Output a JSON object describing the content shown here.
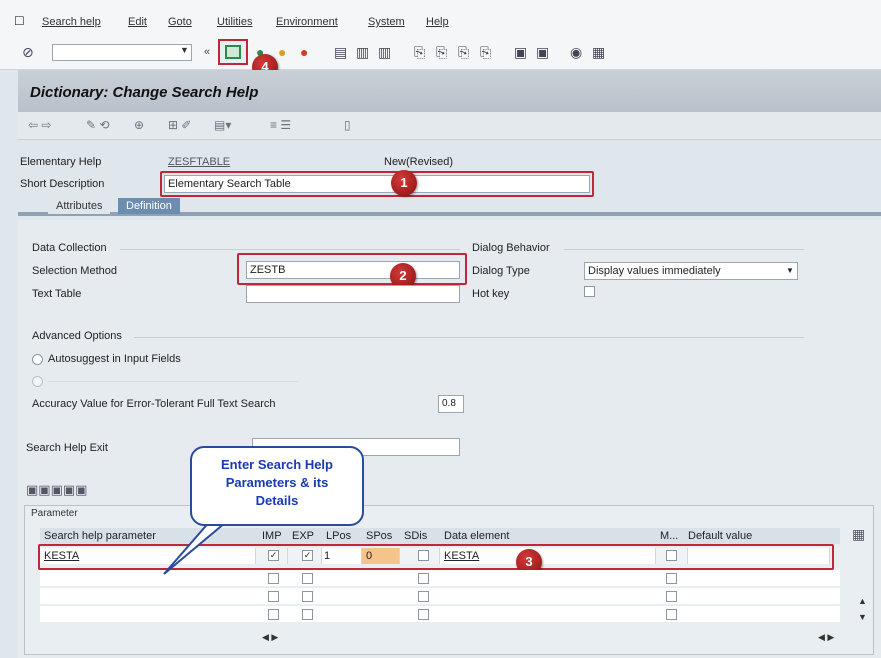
{
  "menu": {
    "items": [
      "Search help",
      "Edit",
      "Goto",
      "Utilities",
      "Environment",
      "System",
      "Help"
    ]
  },
  "toolbar": {
    "command_value": ""
  },
  "title": "Dictionary: Change Search Help",
  "header": {
    "elementary_label": "Elementary Help",
    "elementary_value": "ZESFTABLE",
    "status": "New(Revised)",
    "short_desc_label": "Short Description",
    "short_desc_value": "Elementary Search Table"
  },
  "tabs": [
    "Attributes",
    "Definition"
  ],
  "data_collection": {
    "heading": "Data Collection",
    "selection_method_label": "Selection Method",
    "selection_method_value": "ZESTB",
    "text_table_label": "Text Table",
    "text_table_value": ""
  },
  "dialog": {
    "heading": "Dialog Behavior",
    "type_label": "Dialog Type",
    "type_value": "Display values immediately",
    "hotkey_label": "Hot key"
  },
  "advanced": {
    "heading": "Advanced Options",
    "autosuggest_label": "Autosuggest in Input Fields",
    "accuracy_label": "Accuracy Value for Error-Tolerant Full Text Search",
    "accuracy_value": "0.8"
  },
  "exit": {
    "label": "Search Help Exit",
    "value": ""
  },
  "callout": {
    "text": "Enter Search Help\nParameters & its\nDetails"
  },
  "grid": {
    "group_title": "Parameter",
    "headers": [
      "Search help parameter",
      "IMP",
      "EXP",
      "LPos",
      "SPos",
      "SDis",
      "Data element",
      "M...",
      "Default value"
    ],
    "row1": {
      "param": "KESTA",
      "imp": "✓",
      "exp": "✓",
      "lpos": "1",
      "spos": "0",
      "data_element": "KESTA"
    }
  },
  "badges": [
    "1",
    "2",
    "3",
    "4"
  ],
  "colors": {
    "highlight": "#c0283a",
    "callout_text": "#1a3bb0",
    "title_bg": "#c9d0d7",
    "active_tab": "#6d8db0"
  }
}
